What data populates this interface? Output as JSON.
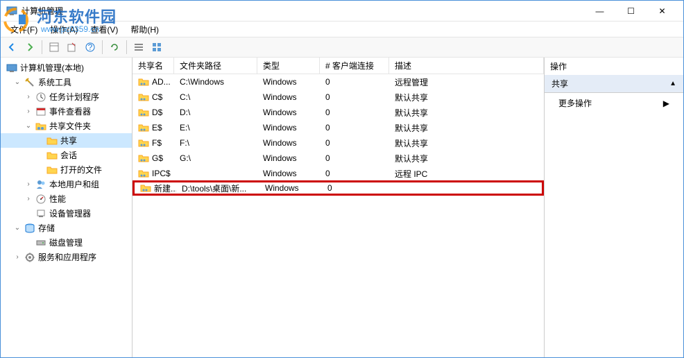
{
  "window": {
    "title": "计算机管理",
    "minimize": "—",
    "maximize": "☐",
    "close": "✕"
  },
  "watermark": {
    "line1": "河东软件园",
    "line2": "www.pc0359.cn"
  },
  "menu": {
    "file": "文件(F)",
    "action": "操作(A)",
    "view": "查看(V)",
    "help": "帮助(H)"
  },
  "tree": {
    "root": "计算机管理(本地)",
    "system_tools": "系统工具",
    "task_scheduler": "任务计划程序",
    "event_viewer": "事件查看器",
    "shared_folders": "共享文件夹",
    "shares": "共享",
    "sessions": "会话",
    "open_files": "打开的文件",
    "local_users": "本地用户和组",
    "performance": "性能",
    "device_manager": "设备管理器",
    "storage": "存储",
    "disk_management": "磁盘管理",
    "services_apps": "服务和应用程序"
  },
  "list": {
    "headers": {
      "name": "共享名",
      "path": "文件夹路径",
      "type": "类型",
      "connections": "# 客户端连接",
      "description": "描述"
    },
    "rows": [
      {
        "name": "AD...",
        "path": "C:\\Windows",
        "type": "Windows",
        "conn": "0",
        "desc": "远程管理"
      },
      {
        "name": "C$",
        "path": "C:\\",
        "type": "Windows",
        "conn": "0",
        "desc": "默认共享"
      },
      {
        "name": "D$",
        "path": "D:\\",
        "type": "Windows",
        "conn": "0",
        "desc": "默认共享"
      },
      {
        "name": "E$",
        "path": "E:\\",
        "type": "Windows",
        "conn": "0",
        "desc": "默认共享"
      },
      {
        "name": "F$",
        "path": "F:\\",
        "type": "Windows",
        "conn": "0",
        "desc": "默认共享"
      },
      {
        "name": "G$",
        "path": "G:\\",
        "type": "Windows",
        "conn": "0",
        "desc": "默认共享"
      },
      {
        "name": "IPC$",
        "path": "",
        "type": "Windows",
        "conn": "0",
        "desc": "远程 IPC"
      },
      {
        "name": "新建...",
        "path": "D:\\tools\\桌面\\新...",
        "type": "Windows",
        "conn": "0",
        "desc": ""
      }
    ]
  },
  "actions": {
    "title": "操作",
    "section": "共享",
    "more": "更多操作"
  }
}
